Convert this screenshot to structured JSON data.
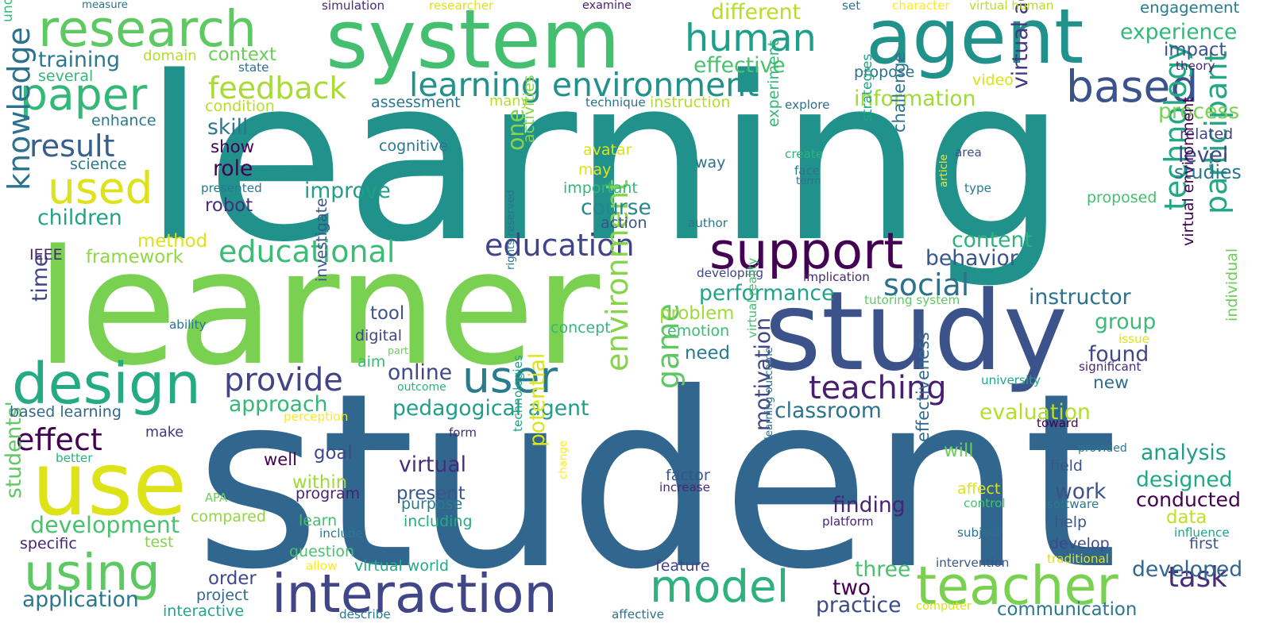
{
  "words": [
    {
      "text": "learning",
      "color": "#21918c"
    },
    {
      "text": "student",
      "color": "#31668e"
    },
    {
      "text": "learner",
      "color": "#7ad151"
    },
    {
      "text": "study",
      "color": "#3b528b"
    },
    {
      "text": "agent",
      "color": "#21918c"
    },
    {
      "text": "system",
      "color": "#44bf70"
    },
    {
      "text": "research",
      "color": "#5ec962"
    },
    {
      "text": "use",
      "color": "#dde318"
    },
    {
      "text": "design",
      "color": "#25ab82"
    },
    {
      "text": "paper",
      "color": "#35b779"
    },
    {
      "text": "using",
      "color": "#5ec962"
    },
    {
      "text": "interaction",
      "color": "#404688"
    },
    {
      "text": "support",
      "color": "#440154"
    },
    {
      "text": "model",
      "color": "#2db27d"
    },
    {
      "text": "teacher",
      "color": "#7ad151"
    },
    {
      "text": "human",
      "color": "#1f9e89"
    },
    {
      "text": "used",
      "color": "#dde318"
    },
    {
      "text": "user",
      "color": "#287c8e"
    },
    {
      "text": "based",
      "color": "#3b528b"
    },
    {
      "text": "learning environment",
      "color": "#21918c"
    },
    {
      "text": "educational",
      "color": "#3bbb75"
    },
    {
      "text": "education",
      "color": "#414487"
    },
    {
      "text": "provide",
      "color": "#414487"
    },
    {
      "text": "teaching",
      "color": "#481f70"
    },
    {
      "text": "result",
      "color": "#355f8d"
    },
    {
      "text": "feedback",
      "color": "#a8db34"
    },
    {
      "text": "effect",
      "color": "#440154"
    },
    {
      "text": "social",
      "color": "#2c728e"
    },
    {
      "text": "participant",
      "color": "#22a884"
    },
    {
      "text": "technology",
      "color": "#22a884"
    },
    {
      "text": "environment",
      "color": "#86d549"
    },
    {
      "text": "task",
      "color": "#472c7a"
    },
    {
      "text": "knowledge",
      "color": "#2c728e"
    },
    {
      "text": "development",
      "color": "#4ac16d"
    },
    {
      "text": "application",
      "color": "#2a788e"
    },
    {
      "text": "game",
      "color": "#5ec962"
    },
    {
      "text": "pedagogical agent",
      "color": "#1f9e89"
    },
    {
      "text": "performance",
      "color": "#20a386"
    },
    {
      "text": "different",
      "color": "#b5de2b"
    },
    {
      "text": "experience",
      "color": "#35b779"
    },
    {
      "text": "engagement",
      "color": "#287c8e"
    },
    {
      "text": "effective",
      "color": "#4ac16d"
    },
    {
      "text": "training",
      "color": "#2a788e"
    },
    {
      "text": "context",
      "color": "#6ccd5a"
    },
    {
      "text": "one",
      "color": "#86d549"
    },
    {
      "text": "information",
      "color": "#a0da39"
    },
    {
      "text": "impact",
      "color": "#39568c"
    },
    {
      "text": "process",
      "color": "#7ad151"
    },
    {
      "text": "level",
      "color": "#3e4989"
    },
    {
      "text": "studies",
      "color": "#2a788e"
    },
    {
      "text": "classroom",
      "color": "#2c728e"
    },
    {
      "text": "instructor",
      "color": "#2c728e"
    },
    {
      "text": "evaluation",
      "color": "#b5de2b"
    },
    {
      "text": "online",
      "color": "#3e4989"
    },
    {
      "text": "approach",
      "color": "#35b779"
    },
    {
      "text": "virtual",
      "color": "#472c7a"
    },
    {
      "text": "analysis",
      "color": "#1f9e89"
    },
    {
      "text": "designed",
      "color": "#22a884"
    },
    {
      "text": "conducted",
      "color": "#440154"
    },
    {
      "text": "work",
      "color": "#3b528b"
    },
    {
      "text": "found",
      "color": "#404688"
    },
    {
      "text": "new",
      "color": "#2d708e"
    },
    {
      "text": "group",
      "color": "#3bbb75"
    },
    {
      "text": "finding",
      "color": "#482475"
    },
    {
      "text": "potential",
      "color": "#dde318"
    },
    {
      "text": "motivation",
      "color": "#414487"
    },
    {
      "text": "practice",
      "color": "#3e4989"
    },
    {
      "text": "two",
      "color": "#440154"
    },
    {
      "text": "three",
      "color": "#4ac16d"
    },
    {
      "text": "developed",
      "color": "#31668e"
    },
    {
      "text": "communication",
      "color": "#2a788e"
    },
    {
      "text": "virtual agent",
      "color": "#453781"
    },
    {
      "text": "children",
      "color": "#20a386"
    },
    {
      "text": "content",
      "color": "#2db27d"
    },
    {
      "text": "behavior",
      "color": "#39568c"
    },
    {
      "text": "course",
      "color": "#23898e"
    },
    {
      "text": "improve",
      "color": "#1f9e89"
    },
    {
      "text": "skill",
      "color": "#2a788e"
    },
    {
      "text": "role",
      "color": "#440154"
    },
    {
      "text": "show",
      "color": "#440154"
    },
    {
      "text": "robot",
      "color": "#472c7a"
    },
    {
      "text": "method",
      "color": "#dde318"
    },
    {
      "text": "framework",
      "color": "#90d743"
    },
    {
      "text": "time",
      "color": "#414487"
    },
    {
      "text": "IEEE",
      "color": "#482475"
    },
    {
      "text": "students'",
      "color": "#5ec962"
    },
    {
      "text": "specific",
      "color": "#482475"
    },
    {
      "text": "based learning",
      "color": "#31688e"
    },
    {
      "text": "make",
      "color": "#46337f"
    },
    {
      "text": "better",
      "color": "#2db27d"
    },
    {
      "text": "test",
      "color": "#86d549"
    },
    {
      "text": "compared",
      "color": "#90d743"
    },
    {
      "text": "program",
      "color": "#481f70"
    },
    {
      "text": "learn",
      "color": "#44bf70"
    },
    {
      "text": "include",
      "color": "#2a788e"
    },
    {
      "text": "question",
      "color": "#4ac16d"
    },
    {
      "text": "allow",
      "color": "#fde725"
    },
    {
      "text": "order",
      "color": "#3e4989"
    },
    {
      "text": "project",
      "color": "#31688e"
    },
    {
      "text": "interactive",
      "color": "#22a884"
    },
    {
      "text": "describe",
      "color": "#2a788e"
    },
    {
      "text": "virtual world",
      "color": "#25ab82"
    },
    {
      "text": "feature",
      "color": "#414487"
    },
    {
      "text": "affective",
      "color": "#2c728e"
    },
    {
      "text": "measure",
      "color": "#2c728e"
    },
    {
      "text": "simulation",
      "color": "#472c7a"
    },
    {
      "text": "researcher",
      "color": "#dde318"
    },
    {
      "text": "examine",
      "color": "#481f70"
    },
    {
      "text": "set",
      "color": "#2a788e"
    },
    {
      "text": "character",
      "color": "#fde725"
    },
    {
      "text": "virtual human",
      "color": "#b5de2b"
    },
    {
      "text": "theory",
      "color": "#482878"
    },
    {
      "text": "domain",
      "color": "#b5de2b"
    },
    {
      "text": "state",
      "color": "#2c728e"
    },
    {
      "text": "several",
      "color": "#35b779"
    },
    {
      "text": "understanding",
      "color": "#35b779"
    },
    {
      "text": "enhance",
      "color": "#2a788e"
    },
    {
      "text": "science",
      "color": "#2a788e"
    },
    {
      "text": "condition",
      "color": "#b5de2b"
    },
    {
      "text": "assessment",
      "color": "#2a788e"
    },
    {
      "text": "many",
      "color": "#b5de2b"
    },
    {
      "text": "propose",
      "color": "#2c728e"
    },
    {
      "text": "video",
      "color": "#dde318"
    },
    {
      "text": "instruction",
      "color": "#b5de2b"
    },
    {
      "text": "technique",
      "color": "#2c728e"
    },
    {
      "text": "explore",
      "color": "#2d708e"
    },
    {
      "text": "cognitive",
      "color": "#2a788e"
    },
    {
      "text": "avatar",
      "color": "#dde318"
    },
    {
      "text": "may",
      "color": "#dde318"
    },
    {
      "text": "important",
      "color": "#35b779"
    },
    {
      "text": "activities",
      "color": "#86d549"
    },
    {
      "text": "way",
      "color": "#2c728e"
    },
    {
      "text": "experiment",
      "color": "#35b779"
    },
    {
      "text": "create",
      "color": "#2db27d"
    },
    {
      "text": "face",
      "color": "#2a788e"
    },
    {
      "text": "term",
      "color": "#2a788e"
    },
    {
      "text": "strategies",
      "color": "#20a386"
    },
    {
      "text": "challenge",
      "color": "#2c728e"
    },
    {
      "text": "area",
      "color": "#3b528b"
    },
    {
      "text": "article",
      "color": "#fde725"
    },
    {
      "text": "type",
      "color": "#2a788e"
    },
    {
      "text": "related",
      "color": "#414487"
    },
    {
      "text": "proposed",
      "color": "#44bf70"
    },
    {
      "text": "presented",
      "color": "#2a788e"
    },
    {
      "text": "action",
      "color": "#3b528b"
    },
    {
      "text": "author",
      "color": "#2a788e"
    },
    {
      "text": "developing",
      "color": "#404688"
    },
    {
      "text": "implication",
      "color": "#482878"
    },
    {
      "text": "tutoring system",
      "color": "#5ec962"
    },
    {
      "text": "problem",
      "color": "#a0da39"
    },
    {
      "text": "emotion",
      "color": "#3bbb75"
    },
    {
      "text": "concept",
      "color": "#35b779"
    },
    {
      "text": "tool",
      "color": "#3b528b"
    },
    {
      "text": "digital",
      "color": "#414487"
    },
    {
      "text": "ability",
      "color": "#2c728e"
    },
    {
      "text": "investigate",
      "color": "#39568c"
    },
    {
      "text": "aim",
      "color": "#3bbb75"
    },
    {
      "text": "part",
      "color": "#6ccd5a"
    },
    {
      "text": "outcome",
      "color": "#2db27d"
    },
    {
      "text": "rights reserved",
      "color": "#2c728e"
    },
    {
      "text": "need",
      "color": "#2a788e"
    },
    {
      "text": "virtual reality",
      "color": "#44bf70"
    },
    {
      "text": "perception",
      "color": "#fde725"
    },
    {
      "text": "form",
      "color": "#482878"
    },
    {
      "text": "technologies",
      "color": "#20a386"
    },
    {
      "text": "change",
      "color": "#fde725"
    },
    {
      "text": "factor",
      "color": "#39568c"
    },
    {
      "text": "increase",
      "color": "#482878"
    },
    {
      "text": "APA",
      "color": "#6ccd5a"
    },
    {
      "text": "purpose",
      "color": "#2a788e"
    },
    {
      "text": "present",
      "color": "#39568c"
    },
    {
      "text": "including",
      "color": "#25ab82"
    },
    {
      "text": "goal",
      "color": "#3e4989"
    },
    {
      "text": "well",
      "color": "#440154"
    },
    {
      "text": "within",
      "color": "#a0da39"
    },
    {
      "text": "learning outcome",
      "color": "#2c728e"
    },
    {
      "text": "effectiveness",
      "color": "#31688e"
    },
    {
      "text": "platform",
      "color": "#482475"
    },
    {
      "text": "will",
      "color": "#6ccd5a"
    },
    {
      "text": "affect",
      "color": "#dde318"
    },
    {
      "text": "control",
      "color": "#44bf70"
    },
    {
      "text": "software",
      "color": "#2a788e"
    },
    {
      "text": "help",
      "color": "#39568c"
    },
    {
      "text": "field",
      "color": "#39568c"
    },
    {
      "text": "subject",
      "color": "#2c728e"
    },
    {
      "text": "develop",
      "color": "#3e4989"
    },
    {
      "text": "traditional",
      "color": "#dde318"
    },
    {
      "text": "intervention",
      "color": "#39568c"
    },
    {
      "text": "computer",
      "color": "#dde318"
    },
    {
      "text": "data",
      "color": "#c2df23"
    },
    {
      "text": "first",
      "color": "#3b528b"
    },
    {
      "text": "influence",
      "color": "#20a386"
    },
    {
      "text": "toward",
      "color": "#440154"
    },
    {
      "text": "provided",
      "color": "#2a788e"
    },
    {
      "text": "significant",
      "color": "#482878"
    },
    {
      "text": "university",
      "color": "#22a884"
    },
    {
      "text": "issue",
      "color": "#dde318"
    },
    {
      "text": "individual",
      "color": "#6ccd5a"
    },
    {
      "text": "virtual environment",
      "color": "#440154"
    }
  ]
}
